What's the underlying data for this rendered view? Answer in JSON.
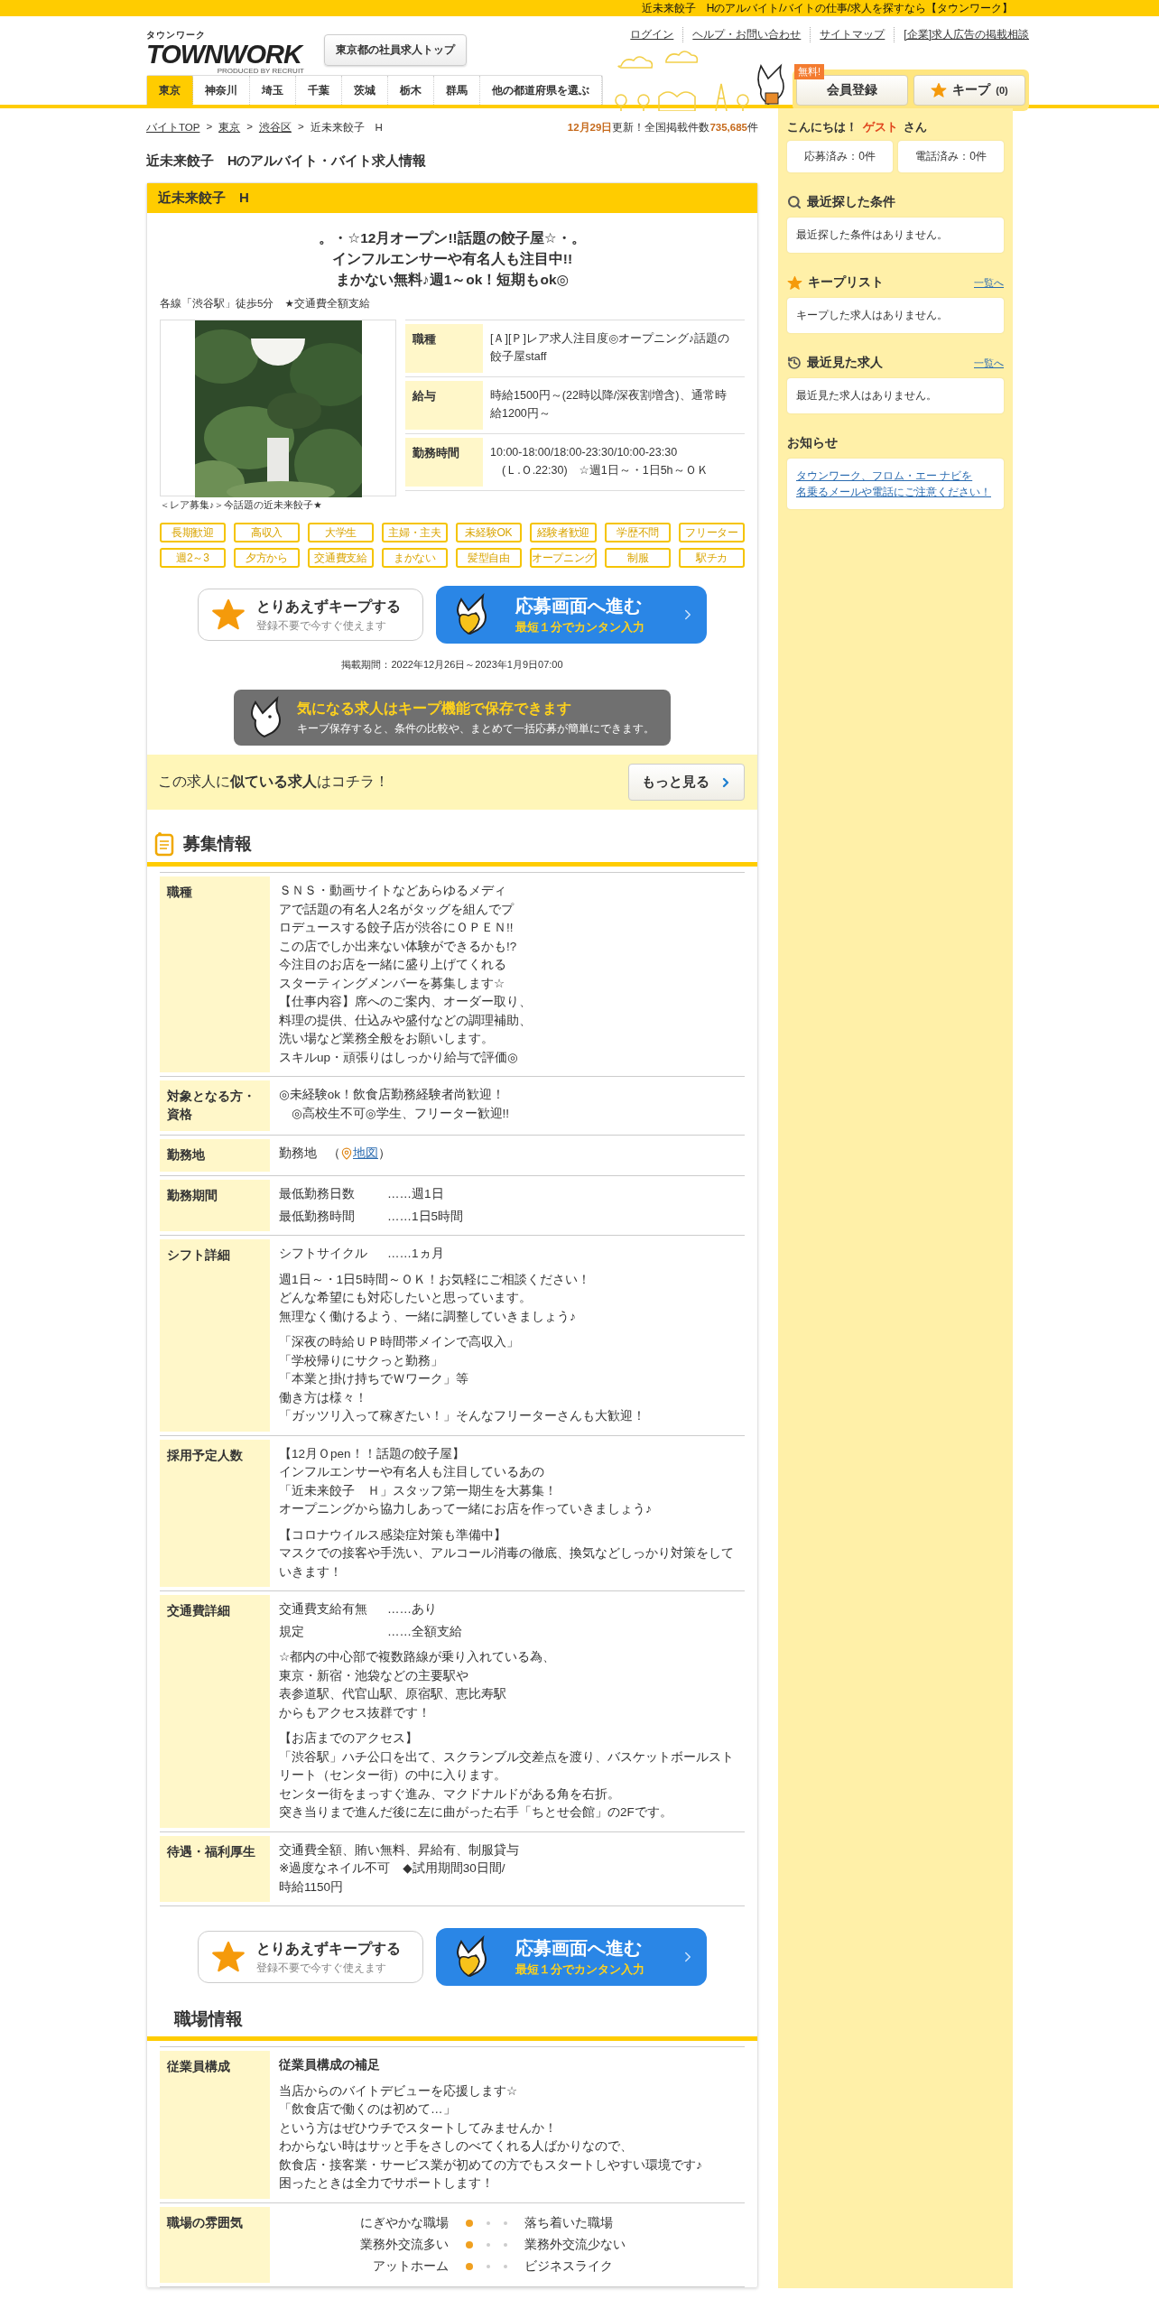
{
  "top_bar": {
    "text": "近未来餃子　Hのアルバイト/バイトの仕事/求人を探すなら【タウンワーク】"
  },
  "header": {
    "logo": {
      "kana": "タウンワーク",
      "main": "TOWNWORK",
      "sub": "PRODUCED BY RECRUIT"
    },
    "top_button": "東京都の社員求人トップ",
    "links": [
      "ログイン",
      "ヘルプ・お問い合わせ",
      "サイトマップ",
      "[企業]求人広告の掲載相談"
    ],
    "member": {
      "badge": "無料!",
      "label": "会員登録"
    },
    "keep": {
      "label": "キープ",
      "count": "(0)"
    },
    "tabs": [
      {
        "label": "東京",
        "selected": true
      },
      {
        "label": "神奈川",
        "selected": false
      },
      {
        "label": "埼玉",
        "selected": false
      },
      {
        "label": "千葉",
        "selected": false
      },
      {
        "label": "茨城",
        "selected": false
      },
      {
        "label": "栃木",
        "selected": false
      },
      {
        "label": "群馬",
        "selected": false
      },
      {
        "label": "他の都道府県を選ぶ",
        "selected": false
      }
    ]
  },
  "breadcrumb": {
    "separator": ">",
    "items": [
      "バイトTOP",
      "東京",
      "渋谷区",
      "近未来餃子　H"
    ]
  },
  "update": {
    "date": "12月29日",
    "middle": "更新！全国掲載件数",
    "count": "735,685",
    "unit": "件"
  },
  "page_title": "近未来餃子　Hのアルバイト・バイト求人情報",
  "job": {
    "name": "近未来餃子　H",
    "catch": [
      "。・☆12月オープン!!話題の餃子屋☆・。",
      "インフルエンサーや有名人も注目中!!",
      "まかない無料♪週1～ok！短期もok◎"
    ],
    "access": "各線「渋谷駅」徒歩5分　★交通費全額支給",
    "image": {
      "kind": "picture",
      "caption": "＜レア募集♪＞今話題の近未来餃子★"
    },
    "details": [
      {
        "label": "職種",
        "value": "[Ａ][Ｐ]レア求人注目度◎オープニング♪話題の餃子屋staff"
      },
      {
        "label": "給与",
        "value": "時給1500円～(22時以降/深夜割増含)、通常時給1200円～"
      },
      {
        "label": "勤務時間",
        "value": "10:00-18:00/18:00-23:30/10:00-23:30",
        "extra": "　(Ｌ.Ｏ.22:30)　☆週1日～・1日5h～ＯＫ"
      }
    ],
    "tags": [
      "長期歓迎",
      "高収入",
      "大学生",
      "主婦・主夫",
      "未経験OK",
      "経験者歓迎",
      "学歴不問",
      "フリーター",
      "週2～3",
      "夕方から",
      "交通費支給",
      "まかない",
      "髪型自由",
      "オープニング",
      "制服",
      "駅チカ"
    ],
    "actions": {
      "keep": {
        "title": "とりあえずキープする",
        "sub": "登録不要で今すぐ使えます"
      },
      "apply": {
        "title": "応募画面へ進む",
        "sub": "最短１分でカンタン入力"
      }
    },
    "period": "掲載期間：2022年12月26日～2023年1月9日07:00",
    "keep_banner": {
      "title": "気になる求人はキープ機能で保存できます",
      "sub": "キープ保存すると、条件の比較や、まとめて一括応募が簡単にできます。"
    },
    "similar": {
      "text": "この求人に**似ている求人**はコチラ！",
      "button": "もっと見る"
    },
    "sections": [
      {
        "title": "募集情報",
        "has_icon": true,
        "rows": [
          {
            "label": "職種",
            "items": [
              {
                "kind": "text",
                "lines": [
                  "ＳＮＳ・動画サイトなどあらゆるメディ",
                  "アで話題の有名人2名がタッグを組んでプ",
                  "ロデュースする餃子店が渋谷にＯＰＥＮ!!",
                  "この店でしか出来ない体験ができるかも!?",
                  "今注目のお店を一緒に盛り上げてくれる",
                  "スターティングメンバーを募集します☆",
                  "【仕事内容】席へのご案内、オーダー取り、",
                  "料理の提供、仕込みや盛付などの調理補助、",
                  "洗い場など業務全般をお願いします。",
                  "スキルup・頑張りはしっかり給与で評価◎"
                ]
              }
            ]
          },
          {
            "label": "対象となる方・資格",
            "items": [
              {
                "kind": "text",
                "lines": [
                  "◎未経験ok！飲食店勤務経験者尚歓迎！",
                  "　◎高校生不可◎学生、フリーター歓迎!!"
                ]
              }
            ]
          },
          {
            "label": "勤務地",
            "items": [
              {
                "kind": "map",
                "text": "勤務地",
                "open": "（",
                "link": "地図",
                "close": "）"
              }
            ]
          },
          {
            "label": "勤務期間",
            "items": [
              {
                "kind": "pair",
                "key": "最低勤務日数",
                "value": "……週1日"
              },
              {
                "kind": "pair",
                "key": "最低勤務時間",
                "value": "……1日5時間"
              }
            ]
          },
          {
            "label": "シフト詳細",
            "items": [
              {
                "kind": "pair",
                "key": "シフトサイクル",
                "value": "……1ヵ月"
              },
              {
                "kind": "text",
                "lines": [
                  "週1日～・1日5時間～ＯＫ！お気軽にご相談ください！",
                  "どんな希望にも対応したいと思っています。",
                  "無理なく働けるよう、一緒に調整していきましょう♪"
                ]
              },
              {
                "kind": "text",
                "lines": [
                  "「深夜の時給ＵＰ時間帯メインで高収入」",
                  "「学校帰りにサクっと勤務」",
                  "「本業と掛け持ちでＷワーク」等",
                  "働き方は様々！",
                  "「ガッツリ入って稼ぎたい！」そんなフリーターさんも大歓迎！"
                ]
              }
            ]
          },
          {
            "label": "採用予定人数",
            "items": [
              {
                "kind": "text",
                "lines": [
                  "【12月Ｏpen！！話題の餃子屋】",
                  "インフルエンサーや有名人も注目しているあの",
                  "「近未来餃子　Ｈ」スタッフ第一期生を大募集！",
                  "オープニングから協力しあって一緒にお店を作っていきましょう♪"
                ]
              },
              {
                "kind": "text",
                "lines": [
                  "【コロナウイルス感染症対策も準備中】",
                  "マスクでの接客や手洗い、アルコール消毒の徹底、換気などしっかり対策をしていきます！"
                ]
              }
            ]
          },
          {
            "label": "交通費詳細",
            "items": [
              {
                "kind": "pair",
                "key": "交通費支給有無",
                "value": "……あり"
              },
              {
                "kind": "pair",
                "key": "規定",
                "value": "……全額支給"
              },
              {
                "kind": "text",
                "lines": [
                  "☆都内の中心部で複数路線が乗り入れている為、",
                  "東京・新宿・池袋などの主要駅や",
                  "表参道駅、代官山駅、原宿駅、恵比寿駅",
                  "からもアクセス抜群です！"
                ]
              },
              {
                "kind": "text",
                "lines": [
                  "【お店までのアクセス】",
                  "「渋谷駅」ハチ公口を出て、スクランブル交差点を渡り、バスケットボールストリート（センター街）の中に入ります。",
                  "センター街をまっすぐ進み、マクドナルドがある角を右折。",
                  "突き当りまで進んだ後に左に曲がった右手「ちとせ会館」の2Fです。"
                ]
              }
            ]
          },
          {
            "label": "待遇・福利厚生",
            "items": [
              {
                "kind": "text",
                "lines": [
                  "交通費全額、賄い無料、昇給有、制服貸与",
                  "※過度なネイル不可　◆試用期間30日間/",
                  "時給1150円"
                ]
              }
            ]
          }
        ],
        "actions": {
          "keep": {
            "title": "とりあえずキープする",
            "sub": "登録不要で今すぐ使えます"
          },
          "apply": {
            "title": "応募画面へ進む",
            "sub": "最短１分でカンタン入力"
          }
        }
      },
      {
        "title": "職場情報",
        "has_icon": false,
        "rows": [
          {
            "label": "従業員構成",
            "items": [
              {
                "kind": "heading",
                "text": "従業員構成の補足"
              },
              {
                "kind": "text",
                "lines": [
                  "当店からのバイトデビューを応援します☆",
                  "「飲食店で働くのは初めて…」",
                  "という方はぜひウチでスタートしてみませんか！",
                  "わからない時はサッと手をさしのべてくれる人ばかりなので、",
                  "飲食店・接客業・サービス業が初めての方でもスタートしやすい環境です♪",
                  "困ったときは全力でサポートします！"
                ]
              }
            ]
          },
          {
            "label": "職場の雰囲気",
            "items": [
              {
                "kind": "scale",
                "rows": [
                  {
                    "left": "にぎやかな職場",
                    "right": "落ち着いた職場",
                    "dots": [
                      {
                        "selected": true
                      },
                      {
                        "selected": false
                      },
                      {
                        "selected": false
                      }
                    ]
                  },
                  {
                    "left": "業務外交流多い",
                    "right": "業務外交流少ない",
                    "dots": [
                      {
                        "selected": true
                      },
                      {
                        "selected": false
                      },
                      {
                        "selected": false
                      }
                    ]
                  },
                  {
                    "left": "アットホーム",
                    "right": "ビジネスライク",
                    "dots": [
                      {
                        "selected": true
                      },
                      {
                        "selected": false
                      },
                      {
                        "selected": false
                      }
                    ]
                  }
                ]
              }
            ]
          }
        ]
      }
    ]
  },
  "sidebar": {
    "greeting": {
      "prefix": "こんにちは！",
      "name": "ゲスト",
      "suffix": "さん"
    },
    "counters": [
      "応募済み：0件",
      "電話済み：0件"
    ],
    "panels": [
      {
        "kind": "search",
        "title": "最近探した条件",
        "empty": "最近探した条件はありません。"
      },
      {
        "kind": "star",
        "title": "キープリスト",
        "link": "一覧へ",
        "empty": "キープした求人はありません。"
      },
      {
        "kind": "history",
        "title": "最近見た求人",
        "link": "一覧へ",
        "empty": "最近見た求人はありません。"
      }
    ],
    "notice": {
      "title": "お知らせ",
      "links": [
        "タウンワーク、フロム・エー ナビを",
        "名乗るメールや電話にご注意ください！"
      ]
    }
  }
}
